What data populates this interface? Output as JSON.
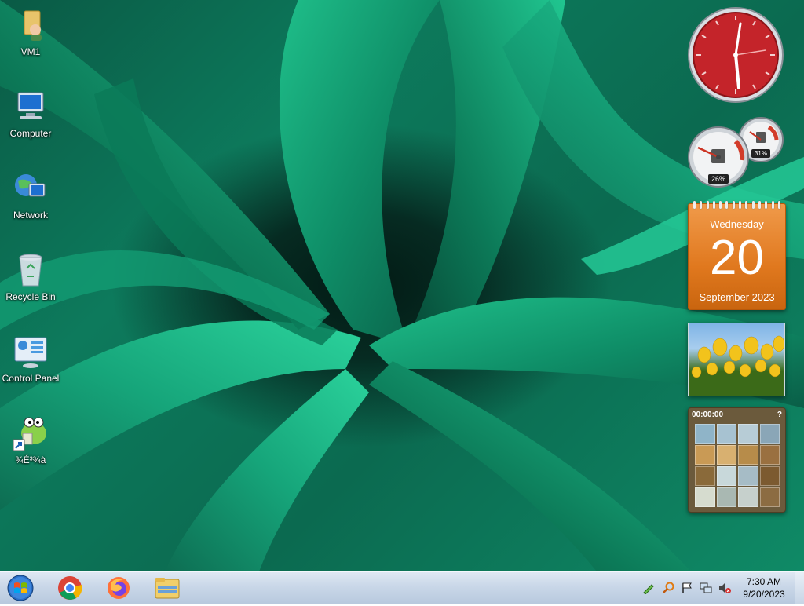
{
  "desktop_icons": [
    {
      "label": "VM1",
      "icon": "user-folder-icon"
    },
    {
      "label": "Computer",
      "icon": "computer-icon"
    },
    {
      "label": "Network",
      "icon": "network-icon"
    },
    {
      "label": "Recycle Bin",
      "icon": "recycle-bin-icon"
    },
    {
      "label": "Control Panel",
      "icon": "control-panel-icon"
    },
    {
      "label": "¾É³¾à",
      "icon": "frog-shortcut-icon"
    }
  ],
  "gadgets": {
    "clock": {
      "accent": "#c4242a"
    },
    "cpu_meter": {
      "cpu": "26%",
      "memory": "31%"
    },
    "calendar": {
      "day": "Wednesday",
      "date": "20",
      "month_year": "September 2023",
      "color": "#e0781e"
    },
    "puzzle": {
      "timer": "00:00:00",
      "help": "?"
    }
  },
  "taskbar": {
    "apps": [
      {
        "name": "chrome-icon"
      },
      {
        "name": "firefox-icon"
      },
      {
        "name": "file-explorer-icon"
      }
    ],
    "tray": {
      "icons": [
        "pen-icon",
        "search-icon",
        "flag-icon",
        "network-tray-icon",
        "volume-muted-icon"
      ],
      "time": "7:30 AM",
      "date": "9/20/2023"
    }
  }
}
